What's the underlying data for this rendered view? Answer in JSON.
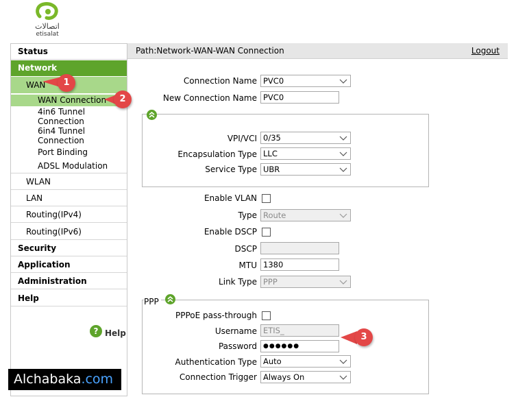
{
  "logo": {
    "arabic": "اتصالات",
    "latin": "etisalat",
    "icon": "etisalat-logo"
  },
  "header": {
    "path": "Path:Network-WAN-WAN Connection",
    "logout": "Logout"
  },
  "sidebar": {
    "status": "Status",
    "network": "Network",
    "wan": "WAN",
    "wan_connection": "WAN Connection",
    "tunnel_4in6_line1": "4in6 Tunnel",
    "tunnel_4in6_line2": "Connection",
    "tunnel_6in4_line1": "6in4 Tunnel",
    "tunnel_6in4_line2": "Connection",
    "port_binding": "Port Binding",
    "adsl_modulation": "ADSL Modulation",
    "wlan": "WLAN",
    "lan": "LAN",
    "routing_ipv4": "Routing(IPv4)",
    "routing_ipv6": "Routing(IPv6)",
    "security": "Security",
    "application": "Application",
    "administration": "Administration",
    "help": "Help",
    "help_link": "Help"
  },
  "form": {
    "connection_name_label": "Connection Name",
    "connection_name_value": "PVC0",
    "new_connection_name_label": "New Connection Name",
    "new_connection_name_value": "PVC0",
    "vpi_vci_label": "VPI/VCI",
    "vpi_vci_value": "0/35",
    "encapsulation_label": "Encapsulation Type",
    "encapsulation_value": "LLC",
    "service_type_label": "Service Type",
    "service_type_value": "UBR",
    "enable_vlan_label": "Enable VLAN",
    "type_label": "Type",
    "type_value": "Route",
    "enable_dscp_label": "Enable DSCP",
    "dscp_label": "DSCP",
    "dscp_value": "",
    "mtu_label": "MTU",
    "mtu_value": "1380",
    "link_type_label": "Link Type",
    "link_type_value": "PPP",
    "ppp_section_label": "PPP",
    "pppoe_passthrough_label": "PPPoE pass-through",
    "username_label": "Username",
    "username_value": "ETIS_",
    "password_label": "Password",
    "password_value": "●●●●●●",
    "auth_type_label": "Authentication Type",
    "auth_type_value": "Auto",
    "connection_trigger_label": "Connection Trigger",
    "connection_trigger_value": "Always On"
  },
  "annotations": {
    "badge1": "1",
    "badge2": "2",
    "badge3": "3"
  },
  "watermark": {
    "part1": "Alchabaka",
    "part2": ".com"
  },
  "colors": {
    "accent_green": "#5ea42b",
    "active_sub": "#a8d88a",
    "badge_red": "#e34747"
  }
}
